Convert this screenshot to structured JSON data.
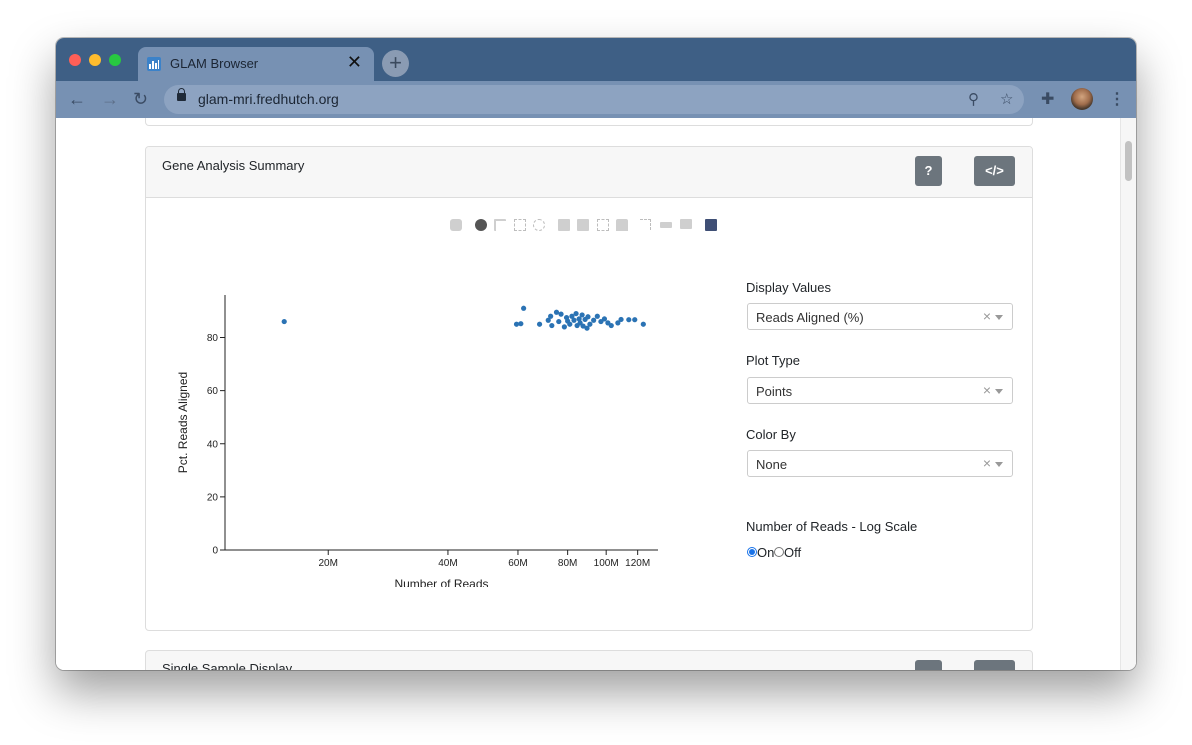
{
  "browser": {
    "tab_title": "GLAM Browser",
    "tab_close": "✕",
    "new_tab": "+",
    "url": "glam-mri.fredhutch.org"
  },
  "card": {
    "title": "Gene Analysis Summary",
    "help_button": "?",
    "code_button": "</>"
  },
  "controls": {
    "display_values": {
      "label": "Display Values",
      "value": "Reads Aligned (%)"
    },
    "plot_type": {
      "label": "Plot Type",
      "value": "Points"
    },
    "color_by": {
      "label": "Color By",
      "value": "None"
    },
    "log_scale": {
      "label": "Number of Reads - Log Scale",
      "on_label": "On",
      "off_label": "Off",
      "selected": "On"
    },
    "clear_glyph": "×"
  },
  "next_card": {
    "title": "Single Sample Display"
  },
  "chart_data": {
    "type": "scatter",
    "xlabel": "Number of Reads",
    "ylabel": "Pct. Reads Aligned",
    "x_scale": "log",
    "x_range": [
      11000000,
      135000000
    ],
    "y_range": [
      0,
      96
    ],
    "x_ticks": [
      {
        "value": 20000000,
        "label": "20M"
      },
      {
        "value": 40000000,
        "label": "40M"
      },
      {
        "value": 60000000,
        "label": "60M"
      },
      {
        "value": 80000000,
        "label": "80M"
      },
      {
        "value": 100000000,
        "label": "100M"
      },
      {
        "value": 120000000,
        "label": "120M"
      }
    ],
    "y_ticks": [
      0,
      20,
      40,
      60,
      80
    ],
    "color": "#2b73b4",
    "grid": false,
    "points": [
      {
        "x": 15500000,
        "y": 86.0
      },
      {
        "x": 59500000,
        "y": 85.0
      },
      {
        "x": 61000000,
        "y": 85.2
      },
      {
        "x": 62000000,
        "y": 91.0
      },
      {
        "x": 68000000,
        "y": 85.0
      },
      {
        "x": 71500000,
        "y": 86.5
      },
      {
        "x": 72500000,
        "y": 88.0
      },
      {
        "x": 73000000,
        "y": 84.5
      },
      {
        "x": 75000000,
        "y": 89.5
      },
      {
        "x": 76000000,
        "y": 86.0
      },
      {
        "x": 77000000,
        "y": 88.8
      },
      {
        "x": 78500000,
        "y": 84.0
      },
      {
        "x": 79500000,
        "y": 87.5
      },
      {
        "x": 80000000,
        "y": 86.2
      },
      {
        "x": 81000000,
        "y": 85.0
      },
      {
        "x": 82000000,
        "y": 88.0
      },
      {
        "x": 83000000,
        "y": 86.5
      },
      {
        "x": 84000000,
        "y": 89.0
      },
      {
        "x": 84500000,
        "y": 84.5
      },
      {
        "x": 85500000,
        "y": 87.0
      },
      {
        "x": 86000000,
        "y": 85.5
      },
      {
        "x": 87000000,
        "y": 88.5
      },
      {
        "x": 87500000,
        "y": 84.3
      },
      {
        "x": 88500000,
        "y": 86.8
      },
      {
        "x": 89500000,
        "y": 83.5
      },
      {
        "x": 90000000,
        "y": 87.8
      },
      {
        "x": 91000000,
        "y": 85.0
      },
      {
        "x": 93000000,
        "y": 86.5
      },
      {
        "x": 95000000,
        "y": 88.0
      },
      {
        "x": 97000000,
        "y": 86.0
      },
      {
        "x": 99000000,
        "y": 87.0
      },
      {
        "x": 101000000,
        "y": 85.5
      },
      {
        "x": 103000000,
        "y": 84.5
      },
      {
        "x": 107000000,
        "y": 85.5
      },
      {
        "x": 109000000,
        "y": 86.8
      },
      {
        "x": 114000000,
        "y": 86.7
      },
      {
        "x": 118000000,
        "y": 86.7
      },
      {
        "x": 124000000,
        "y": 85.0
      }
    ]
  }
}
